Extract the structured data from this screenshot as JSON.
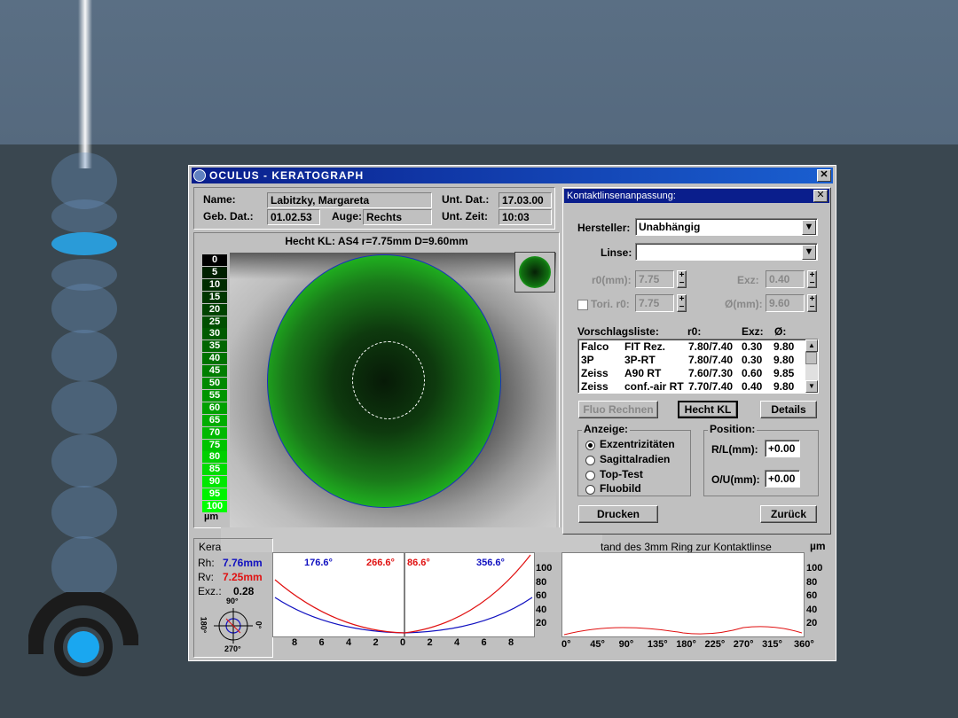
{
  "window": {
    "title": "OCULUS  -  KERATOGRAPH"
  },
  "patient": {
    "name_label": "Name:",
    "name": "Labitzky, Margareta",
    "dob_label": "Geb. Dat.:",
    "dob": "01.02.53",
    "eye_label": "Auge:",
    "eye": "Rechts",
    "exam_date_label": "Unt. Dat.:",
    "exam_date": "17.03.00",
    "exam_time_label": "Unt. Zeit:",
    "exam_time": "10:03"
  },
  "image_panel": {
    "title": "Hecht KL: AS4 r=7.75mm  D=9.60mm"
  },
  "scale": {
    "values": [
      "0",
      "5",
      "10",
      "15",
      "20",
      "25",
      "30",
      "35",
      "40",
      "45",
      "50",
      "55",
      "60",
      "65",
      "70",
      "75",
      "80",
      "85",
      "90",
      "95",
      "100"
    ],
    "unit": "µm"
  },
  "kera": {
    "title": "Kera",
    "rh_label": "Rh:",
    "rh": "7.76mm",
    "rv_label": "Rv:",
    "rv": "7.25mm",
    "exz_label": "Exz.:",
    "exz": "0.28",
    "deg_top": "90°",
    "deg_right": "0°",
    "deg_bottom": "270°",
    "deg_left": "180°"
  },
  "profile": {
    "angles": [
      "176.6°",
      "266.6°",
      "86.6°",
      "356.6°"
    ],
    "x_ticks": [
      "8",
      "6",
      "4",
      "2",
      "0",
      "2",
      "4",
      "6",
      "8"
    ],
    "y_ticks": [
      "100",
      "80",
      "60",
      "40",
      "20"
    ]
  },
  "ring": {
    "title": "tand des 3mm Ring zur Kontaktlinse",
    "unit": "µm",
    "y_ticks": [
      "100",
      "80",
      "60",
      "40",
      "20"
    ],
    "x_ticks": [
      "0°",
      "45°",
      "90°",
      "135°",
      "180°",
      "225°",
      "270°",
      "315°",
      "360°"
    ]
  },
  "fitting": {
    "title": "Kontaktlinsenanpassung:",
    "manufacturer_label": "Hersteller:",
    "manufacturer": "Unabhängig",
    "lens_label": "Linse:",
    "lens": "",
    "r0_label": "r0(mm):",
    "r0": "7.75",
    "exz_label": "Exz:",
    "exz": "0.40",
    "tori_label": "Tori. r0:",
    "tori": "7.75",
    "diam_label": "Ø(mm):",
    "diam": "9.60",
    "list_label": "Vorschlagsliste:",
    "col_r0": "r0:",
    "col_exz": "Exz:",
    "col_d": "Ø:",
    "rows": [
      {
        "maker": "Falco",
        "model": "FIT Rez.",
        "r0": "7.80/7.40",
        "exz": "0.30",
        "d": "9.80"
      },
      {
        "maker": "3P",
        "model": "3P-RT",
        "r0": "7.80/7.40",
        "exz": "0.30",
        "d": "9.80"
      },
      {
        "maker": "Zeiss",
        "model": "A90 RT",
        "r0": "7.60/7.30",
        "exz": "0.60",
        "d": "9.85"
      },
      {
        "maker": "Zeiss",
        "model": "conf.-air RT",
        "r0": "7.70/7.40",
        "exz": "0.40",
        "d": "9.80"
      }
    ],
    "btn_fluo": "Fluo Rechnen",
    "btn_hecht": "Hecht KL",
    "btn_details": "Details",
    "display_label": "Anzeige:",
    "display_options": [
      "Exzentrizitäten",
      "Sagittalradien",
      "Top-Test",
      "Fluobild"
    ],
    "position_label": "Position:",
    "rl_label": "R/L(mm):",
    "rl": "+0.00",
    "ou_label": "O/U(mm):",
    "ou": "+0.00",
    "btn_print": "Drucken",
    "btn_back": "Zurück"
  },
  "colors": {
    "fluo_green": "#22dd22",
    "title_blue": "#0a1e8c",
    "rh_blue": "#1010c0",
    "rv_red": "#e01010"
  }
}
